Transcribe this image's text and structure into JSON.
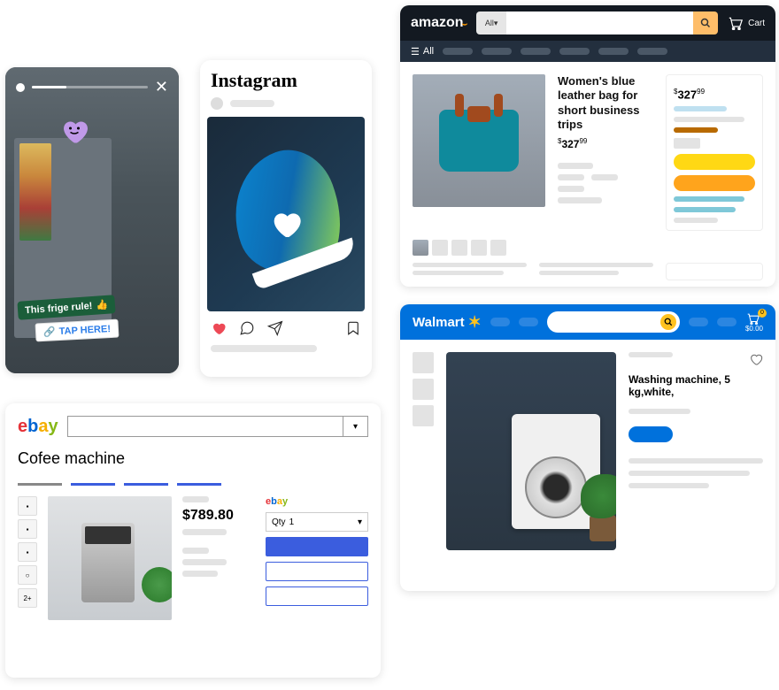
{
  "story": {
    "tag1_text": "This frige rule!",
    "tag1_emoji": "👍",
    "tag2_text": "TAP HERE!",
    "heart_face": "^_^"
  },
  "instagram": {
    "logo": "Instagram"
  },
  "amazon": {
    "logo_text": "amazon",
    "search_category": "All",
    "cart_label": "Cart",
    "subnav_all": "All",
    "product_title": "Women's blue leather bag for short business trips",
    "price_currency": "$",
    "price_main": "327",
    "price_cents": "99",
    "buybox_price_currency": "$",
    "buybox_price_main": "327",
    "buybox_price_cents": "99"
  },
  "walmart": {
    "logo": "Walmart",
    "cart_count": "0",
    "cart_total": "$0.00",
    "product_title": "Washing machine, 5 kg,white,"
  },
  "ebay": {
    "search_placeholder": "",
    "product_title": "Cofee machine",
    "price": "$789.80",
    "qty_label": "Qty",
    "qty_value": "1",
    "more_thumbs": "2+",
    "buy_logo": "ebay"
  }
}
